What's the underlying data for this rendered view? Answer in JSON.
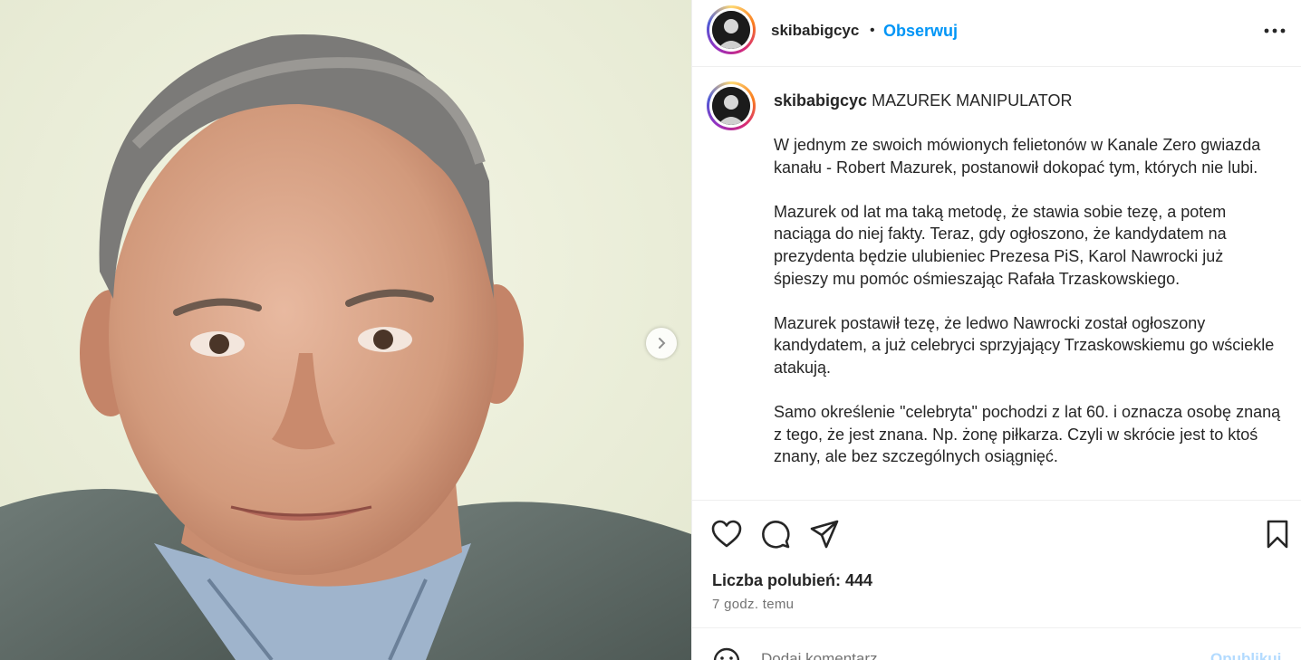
{
  "post": {
    "username": "skibabigcyc",
    "dot": "•",
    "follow_label": "Obserwuj",
    "more_icon": "more-options-icon"
  },
  "caption": {
    "username": "skibabigcyc",
    "title": "MAZUREK MANIPULATOR",
    "paragraphs": [
      "W jednym ze swoich mówionych felietonów w Kanale Zero gwiazda kanału - Robert Mazurek, postanowił dokopać tym, których nie lubi.",
      "Mazurek od lat ma taką metodę, że stawia sobie tezę, a potem naciąga do niej fakty. Teraz, gdy ogłoszono, że kandydatem na prezydenta będzie ulubieniec Prezesa PiS, Karol Nawrocki już śpieszy mu pomóc ośmieszając Rafała Trzaskowskiego.",
      "Mazurek postawił tezę, że ledwo Nawrocki został ogłoszony kandydatem, a już celebryci sprzyjający Trzaskowskiemu go wściekle atakują.",
      "Samo określenie \"celebryta\" pochodzi z lat 60. i oznacza osobę znaną z tego, że jest znana. Np. żonę piłkarza. Czyli w skrócie jest to ktoś znany, ale bez szczególnych osiągnięć."
    ]
  },
  "stats": {
    "likes": "Liczba polubień: 444",
    "time": "7 godz. temu"
  },
  "comment": {
    "placeholder": "Dodaj komentarz...",
    "publish_label": "Opublikuj"
  },
  "colors": {
    "accent": "#0095f6",
    "text": "#262626",
    "muted": "#737373",
    "publish_disabled": "#b3dbff"
  }
}
